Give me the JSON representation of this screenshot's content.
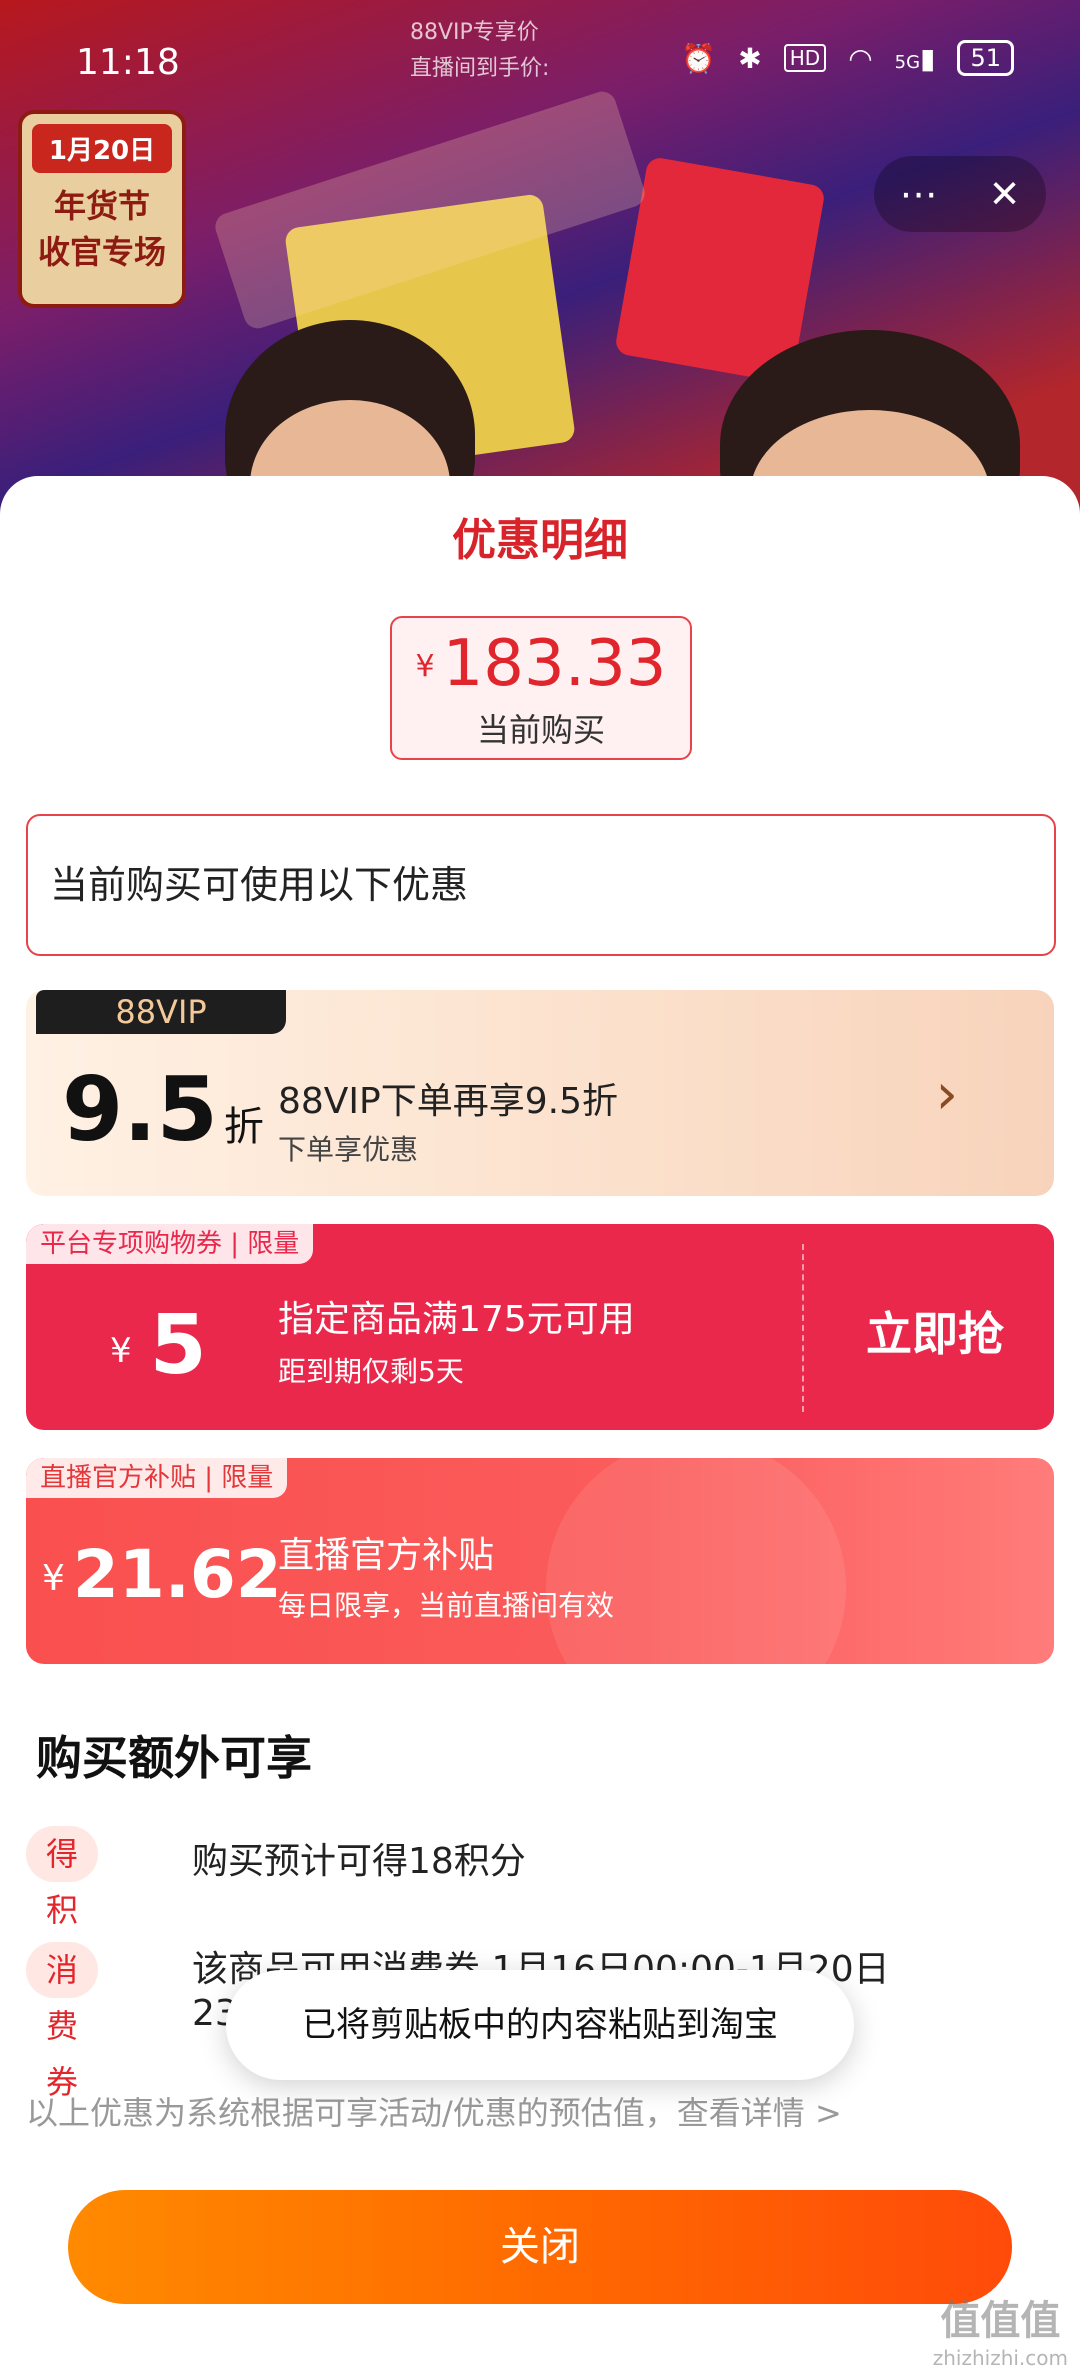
{
  "status_bar": {
    "time": "11:18",
    "hd": "HD",
    "network": "5G",
    "battery": "51"
  },
  "background": {
    "promo_chip": "88VIP专享价",
    "promo_price_label": "直播间到手价:",
    "badge_date": "1月20日",
    "badge_line1": "年货节",
    "badge_line2": "收官专场",
    "more_icon": "more-icon",
    "close_icon": "close-icon"
  },
  "sheet": {
    "title": "优惠明细",
    "price": {
      "currency": "¥",
      "amount": "183.33",
      "caption": "当前购买"
    },
    "callout": "当前购买可使用以下优惠"
  },
  "cards": {
    "vip": {
      "tag": "88VIP",
      "discount": "9.5",
      "unit": "折",
      "line1": "88VIP下单再享9.5折",
      "line2": "下单享优惠"
    },
    "coupon": {
      "tag": "平台专项购物券 | 限量",
      "currency": "¥",
      "amount": "5",
      "line1": "指定商品满175元可用",
      "line2": "距到期仅剩5天",
      "cta": "立即抢"
    },
    "subsidy": {
      "tag": "直播官方补贴 | 限量",
      "currency": "¥",
      "amount": "21.62",
      "line1": "直播官方补贴",
      "line2": "每日限享，当前直播间有效"
    }
  },
  "extras": {
    "title": "购买额外可享",
    "items": [
      {
        "pill": "得积分",
        "text": "购买预计可得18积分"
      },
      {
        "pill": "消费券",
        "text": "该商品可用消费券 1月16日00:00-1月20日 23:"
      }
    ]
  },
  "disclaimer": "以上优惠为系统根据可享活动/优惠的预估值，查看详情 >",
  "toast": "已将剪贴板中的内容粘贴到淘宝",
  "close_button": "关闭",
  "watermark": {
    "main": "值值值",
    "sub": "zhizhizhi.com"
  },
  "colors": {
    "accent_red": "#d8232a",
    "coupon_red": "#e9284c",
    "subsidy_red": "#fa4f4f",
    "close_orange": "#ff6a00"
  }
}
